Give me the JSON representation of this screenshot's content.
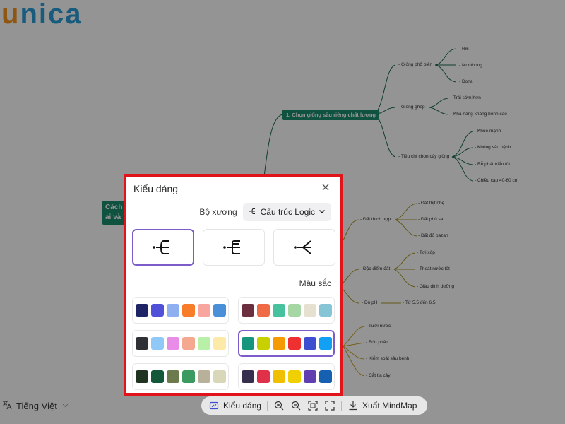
{
  "logo": {
    "text_u": "u",
    "text_rest": "nica"
  },
  "mindmap": {
    "root_label": "Cách ai và",
    "topic_label": "1. Chọn giống sầu riêng chất lượng",
    "branches": [
      {
        "label": "- Giống phổ biến",
        "leaves": [
          "- Ri6",
          "- Monthong",
          "- Dona"
        ]
      },
      {
        "label": "- Giống ghép",
        "leaves": [
          "- Trái sớm hơn",
          "- Khả năng kháng bệnh cao"
        ]
      },
      {
        "label": "- Tiêu chí chọn cây giống",
        "leaves": [
          "- Khỏe mạnh",
          "- Không sâu bệnh",
          "- Rễ phát triển tốt",
          "- Chiều cao 40-60 cm"
        ]
      }
    ],
    "soil_branches": [
      {
        "label": "- Đất thích hợp",
        "leaves": [
          "- Đất thịt nhẹ",
          "- Đất phù sa",
          "- Đất đỏ bazan"
        ]
      },
      {
        "label": "- Đặc điểm đất",
        "leaves": [
          "- Tơi xốp",
          "- Thoát nước tốt",
          "- Giàu dinh dưỡng"
        ]
      },
      {
        "label": "- Độ pH",
        "leaves": [
          "- Từ 5.5 đến 6.5"
        ]
      }
    ],
    "care_leaves": [
      "- Tưới nước",
      "- Bón phân",
      "- Kiểm soát sâu bệnh",
      "- Cắt tỉa cây"
    ],
    "line_colors": {
      "green": "#1a6b4c",
      "olive": "#a89a2a",
      "gold": "#c9a227"
    }
  },
  "language": {
    "label": "Tiếng Việt",
    "icon": "translate-icon"
  },
  "toolbar": {
    "style_label": "Kiểu dáng",
    "export_label": "Xuất MindMap",
    "icons": [
      "style-icon",
      "zoom-in-icon",
      "zoom-out-icon",
      "fit-screen-icon",
      "fullscreen-icon",
      "download-icon"
    ]
  },
  "modal": {
    "title": "Kiểu dáng",
    "skeleton_label": "Bộ xương",
    "skeleton_value": "Cấu trúc Logic",
    "color_label": "Màu sắc",
    "selected_layout": 0,
    "selected_palette": 3,
    "accent_color": "#7b5cc8",
    "highlight_border": "#e0141a",
    "palettes": [
      [
        "#1f2466",
        "#5050d8",
        "#8fb0f0",
        "#f77d2a",
        "#f8a5a0",
        "#4a90d9"
      ],
      [
        "#6b2f3f",
        "#ef6a45",
        "#46c39e",
        "#a7d6a5",
        "#e6e0d0",
        "#86c5d6"
      ],
      [
        "#2f3136",
        "#90c8f8",
        "#e88ce8",
        "#f5a890",
        "#b8f0a8",
        "#fde9a8"
      ],
      [
        "#15957e",
        "#c8d000",
        "#f59b00",
        "#ef3030",
        "#3d4fd0",
        "#12a0f5"
      ],
      [
        "#1f3320",
        "#14583a",
        "#6c7a4c",
        "#3a9a60",
        "#b8b098",
        "#d8d8b8"
      ],
      [
        "#36304e",
        "#e0304a",
        "#f0c000",
        "#f0d000",
        "#6040b0",
        "#1560b0"
      ]
    ]
  }
}
